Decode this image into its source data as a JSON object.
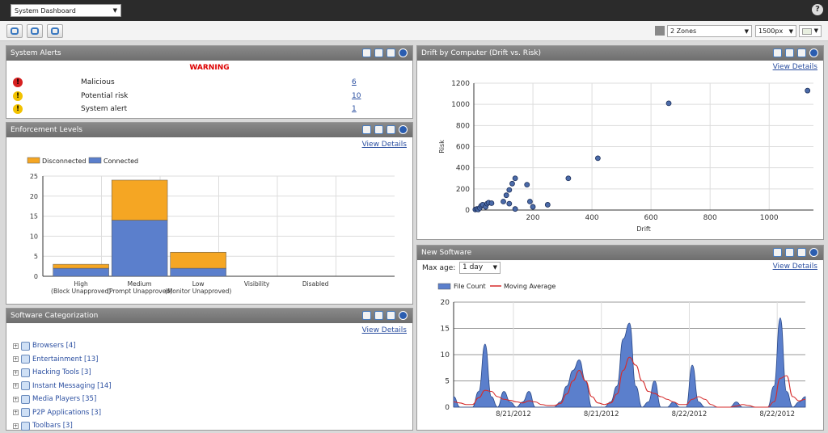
{
  "topbar": {
    "dashboard_select": "System Dashboard",
    "help": "?"
  },
  "toolbar": {
    "zones_select": "2 Zones",
    "width_select": "1500px"
  },
  "system_alerts": {
    "title": "System Alerts",
    "warning": "WARNING",
    "rows": [
      {
        "label": "Malicious",
        "count": "6",
        "color": "#d62020"
      },
      {
        "label": "Potential risk",
        "count": "10",
        "color": "#f2c200"
      },
      {
        "label": "System alert",
        "count": "1",
        "color": "#f2c200"
      }
    ]
  },
  "enforcement": {
    "title": "Enforcement Levels",
    "view_details": "View Details"
  },
  "categorization": {
    "title": "Software Categorization",
    "view_details": "View Details",
    "items": [
      {
        "label": "Browsers [4]",
        "icon": "browser-icon"
      },
      {
        "label": "Entertainment [13]",
        "icon": "entertainment-icon"
      },
      {
        "label": "Hacking Tools [3]",
        "icon": "hacking-tools-icon"
      },
      {
        "label": "Instant Messaging [14]",
        "icon": "chat-icon"
      },
      {
        "label": "Media Players [35]",
        "icon": "media-player-icon"
      },
      {
        "label": "P2P Applications [3]",
        "icon": "p2p-icon"
      },
      {
        "label": "Toolbars [3]",
        "icon": "toolbar-icon"
      }
    ]
  },
  "drift": {
    "title": "Drift by Computer (Drift vs. Risk)",
    "view_details": "View Details"
  },
  "new_software": {
    "title": "New Software",
    "view_details": "View Details",
    "max_age_label": "Max age:",
    "max_age_value": "1 day"
  },
  "colors": {
    "orange": "#f5a623",
    "blue": "#5b7fcc",
    "red": "#d52b2b"
  },
  "chart_data": [
    {
      "type": "bar",
      "stacked": true,
      "categories": [
        "High (Block Unapproved)",
        "Medium (Prompt Unapproved)",
        "Low (Monitor Unapproved)",
        "Visibility",
        "Disabled"
      ],
      "series": [
        {
          "name": "Connected",
          "values": [
            2,
            14,
            2,
            0,
            0
          ],
          "color": "#5b7fcc"
        },
        {
          "name": "Disconnected",
          "values": [
            1,
            10,
            4,
            0,
            0
          ],
          "color": "#f5a623"
        }
      ],
      "legend_order": [
        "Disconnected",
        "Connected"
      ],
      "ylim": [
        0,
        25
      ],
      "yticks": [
        "0",
        "5",
        "10",
        "15",
        "20",
        "25"
      ],
      "grid": true,
      "legend": "top-left"
    },
    {
      "type": "scatter",
      "xlabel": "Drift",
      "ylabel": "Risk",
      "xlim": [
        0,
        1150
      ],
      "ylim": [
        0,
        1200
      ],
      "xticks": [
        "200",
        "400",
        "600",
        "800",
        "1000"
      ],
      "yticks": [
        "0",
        "200",
        "400",
        "600",
        "800",
        "1000",
        "1200"
      ],
      "grid": true,
      "points": [
        [
          5,
          5
        ],
        [
          10,
          10
        ],
        [
          15,
          5
        ],
        [
          20,
          20
        ],
        [
          25,
          40
        ],
        [
          30,
          50
        ],
        [
          40,
          30
        ],
        [
          45,
          60
        ],
        [
          50,
          70
        ],
        [
          60,
          65
        ],
        [
          100,
          80
        ],
        [
          110,
          140
        ],
        [
          120,
          190
        ],
        [
          130,
          250
        ],
        [
          140,
          300
        ],
        [
          120,
          60
        ],
        [
          140,
          10
        ],
        [
          180,
          240
        ],
        [
          190,
          80
        ],
        [
          200,
          30
        ],
        [
          250,
          50
        ],
        [
          320,
          300
        ],
        [
          420,
          490
        ],
        [
          660,
          1010
        ],
        [
          1130,
          1130
        ]
      ]
    },
    {
      "type": "area",
      "ylim": [
        0,
        20
      ],
      "yticks": [
        "0",
        "5",
        "10",
        "15",
        "20"
      ],
      "xticks": [
        "8/21/2012",
        "8/21/2012",
        "8/22/2012",
        "8/22/2012"
      ],
      "grid": true,
      "legend": "top-left",
      "series": [
        {
          "name": "File Count",
          "color": "#5b7fcc",
          "values": [
            2,
            0,
            0,
            0,
            3,
            12,
            2,
            0,
            3,
            1,
            0,
            1,
            3,
            0,
            0,
            0,
            0,
            1,
            4,
            7,
            9,
            5,
            0,
            0,
            0,
            1,
            4,
            13,
            16,
            4,
            0,
            1,
            5,
            0,
            0,
            1,
            0,
            0,
            8,
            1,
            0,
            0,
            0,
            0,
            0,
            1,
            0,
            0,
            0,
            0,
            0,
            4,
            17,
            3,
            0,
            1,
            2
          ]
        },
        {
          "name": "Moving Average",
          "color": "#d52b2b",
          "values": [
            1,
            0.8,
            0.5,
            0.5,
            1.8,
            3.2,
            3,
            2,
            1.5,
            1.3,
            1,
            0.8,
            1.2,
            1,
            0.5,
            0.3,
            0.3,
            0.7,
            2.5,
            5,
            7,
            5,
            2,
            0.8,
            0.5,
            0.8,
            2.5,
            7,
            9.5,
            8,
            5,
            3,
            2.6,
            2,
            1.5,
            1,
            0.5,
            0.5,
            1.5,
            2,
            1.5,
            0.5,
            0,
            0,
            0,
            0.2,
            0.5,
            0.3,
            0,
            0,
            0,
            1,
            5.5,
            6,
            2,
            1.2,
            1.5
          ]
        }
      ]
    }
  ]
}
